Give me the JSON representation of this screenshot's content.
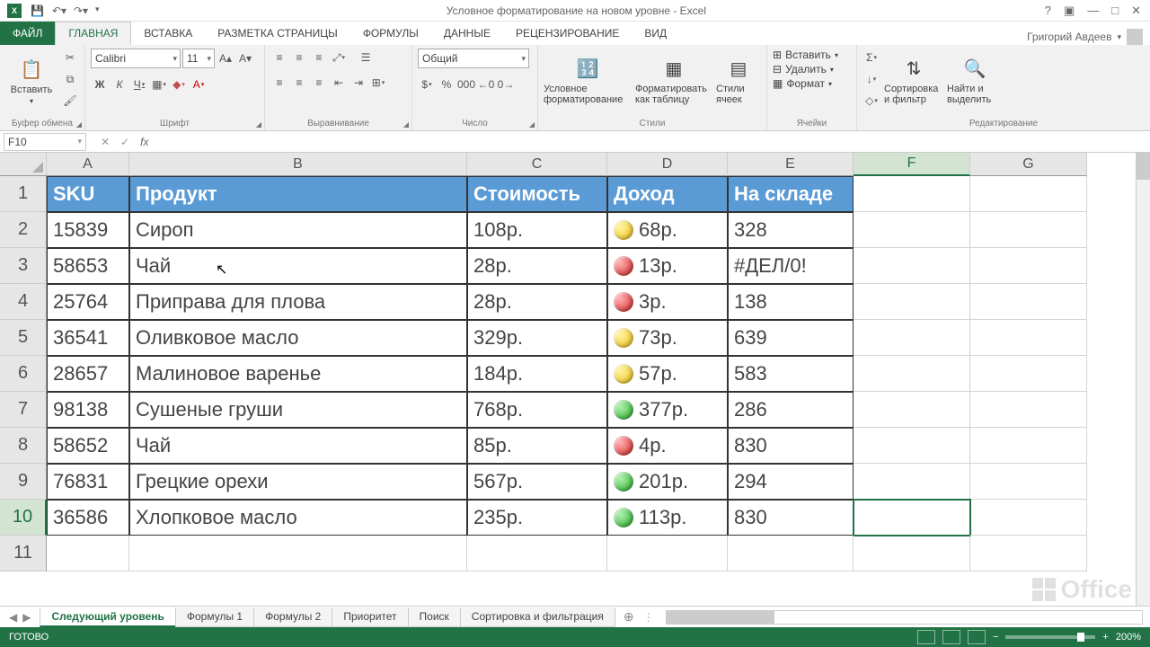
{
  "titlebar": {
    "title": "Условное форматирование на новом уровне - Excel",
    "user": "Григорий Авдеев"
  },
  "ribbon_tabs": {
    "file": "ФАЙЛ",
    "list": [
      "ГЛАВНАЯ",
      "ВСТАВКА",
      "РАЗМЕТКА СТРАНИЦЫ",
      "ФОРМУЛЫ",
      "ДАННЫЕ",
      "РЕЦЕНЗИРОВАНИЕ",
      "ВИД"
    ],
    "active": 0
  },
  "ribbon": {
    "clipboard": {
      "label": "Буфер обмена",
      "paste": "Вставить"
    },
    "font": {
      "label": "Шрифт",
      "name": "Calibri",
      "size": "11",
      "bold": "Ж",
      "italic": "К",
      "underline": "Ч"
    },
    "alignment": {
      "label": "Выравнивание"
    },
    "number": {
      "label": "Число",
      "format": "Общий"
    },
    "styles": {
      "label": "Стили",
      "cond": "Условное форматирование",
      "astable": "Форматировать как таблицу",
      "cellstyles": "Стили ячеек"
    },
    "cells": {
      "label": "Ячейки",
      "insert": "Вставить",
      "delete": "Удалить",
      "format": "Формат"
    },
    "editing": {
      "label": "Редактирование",
      "sort": "Сортировка и фильтр",
      "find": "Найти и выделить"
    }
  },
  "namebox": "F10",
  "columns": [
    "A",
    "B",
    "C",
    "D",
    "E",
    "F",
    "G"
  ],
  "row_count": 11,
  "headers": {
    "A": "SKU",
    "B": "Продукт",
    "C": "Стоимость",
    "D": "Доход",
    "E": "На складе"
  },
  "rows": [
    {
      "A": "15839",
      "B": "Сироп",
      "C": "108р.",
      "Dicon": "yellow",
      "D": "68р.",
      "E": "328"
    },
    {
      "A": "58653",
      "B": "Чай",
      "C": "28р.",
      "Dicon": "red",
      "D": "13р.",
      "E": "#ДЕЛ/0!"
    },
    {
      "A": "25764",
      "B": "Приправа для плова",
      "C": "28р.",
      "Dicon": "red",
      "D": "3р.",
      "E": "138"
    },
    {
      "A": "36541",
      "B": "Оливковое масло",
      "C": "329р.",
      "Dicon": "yellow",
      "D": "73р.",
      "E": "639"
    },
    {
      "A": "28657",
      "B": "Малиновое варенье",
      "C": "184р.",
      "Dicon": "yellow",
      "D": "57р.",
      "E": "583"
    },
    {
      "A": "98138",
      "B": "Сушеные груши",
      "C": "768р.",
      "Dicon": "green",
      "D": "377р.",
      "E": "286"
    },
    {
      "A": "58652",
      "B": "Чай",
      "C": "85р.",
      "Dicon": "red",
      "D": "4р.",
      "E": "830"
    },
    {
      "A": "76831",
      "B": "Грецкие орехи",
      "C": "567р.",
      "Dicon": "green",
      "D": "201р.",
      "E": "294"
    },
    {
      "A": "36586",
      "B": "Хлопковое масло",
      "C": "235р.",
      "Dicon": "green",
      "D": "113р.",
      "E": "830"
    }
  ],
  "selected_cell": "F10",
  "sheet_tabs": {
    "active": 0,
    "list": [
      "Следующий уровень",
      "Формулы 1",
      "Формулы 2",
      "Приоритет",
      "Поиск",
      "Сортировка и фильтрация"
    ]
  },
  "status": {
    "ready": "ГОТОВО",
    "zoom": "200%"
  }
}
